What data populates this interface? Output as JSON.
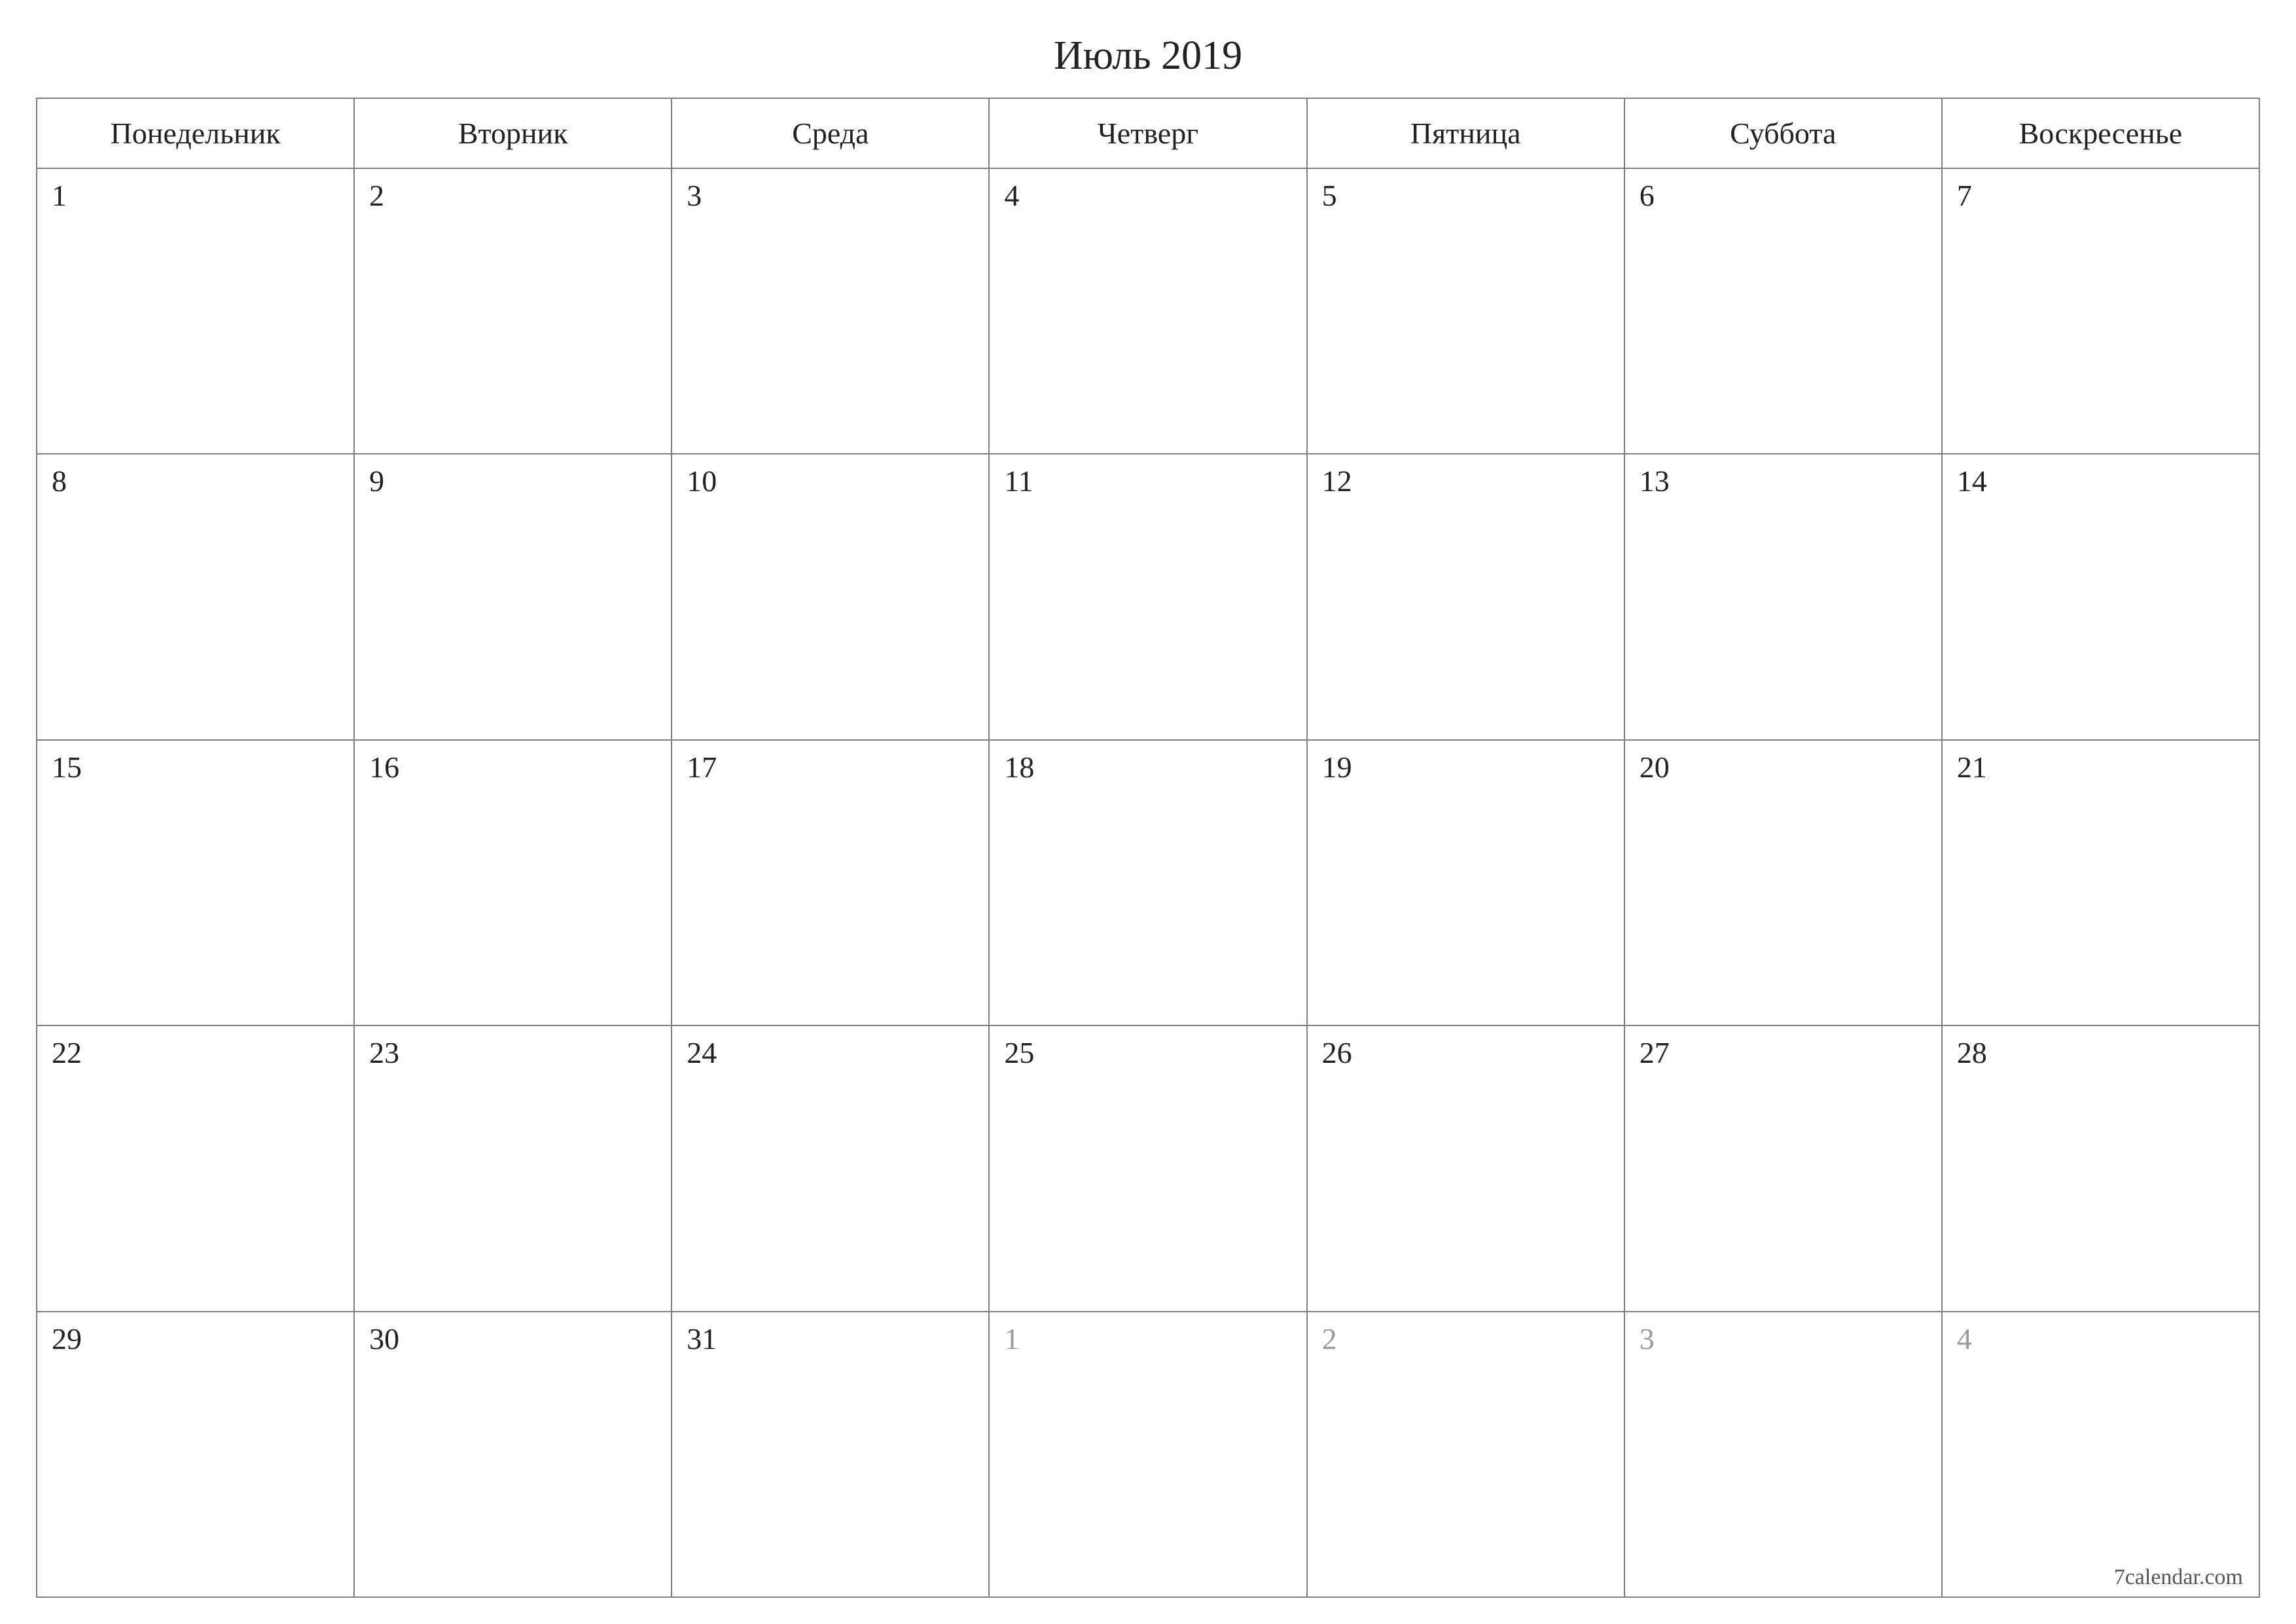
{
  "title": "Июль 2019",
  "weekdays": [
    "Понедельник",
    "Вторник",
    "Среда",
    "Четверг",
    "Пятница",
    "Суббота",
    "Воскресенье"
  ],
  "weeks": [
    [
      {
        "n": "1",
        "other": false
      },
      {
        "n": "2",
        "other": false
      },
      {
        "n": "3",
        "other": false
      },
      {
        "n": "4",
        "other": false
      },
      {
        "n": "5",
        "other": false
      },
      {
        "n": "6",
        "other": false
      },
      {
        "n": "7",
        "other": false
      }
    ],
    [
      {
        "n": "8",
        "other": false
      },
      {
        "n": "9",
        "other": false
      },
      {
        "n": "10",
        "other": false
      },
      {
        "n": "11",
        "other": false
      },
      {
        "n": "12",
        "other": false
      },
      {
        "n": "13",
        "other": false
      },
      {
        "n": "14",
        "other": false
      }
    ],
    [
      {
        "n": "15",
        "other": false
      },
      {
        "n": "16",
        "other": false
      },
      {
        "n": "17",
        "other": false
      },
      {
        "n": "18",
        "other": false
      },
      {
        "n": "19",
        "other": false
      },
      {
        "n": "20",
        "other": false
      },
      {
        "n": "21",
        "other": false
      }
    ],
    [
      {
        "n": "22",
        "other": false
      },
      {
        "n": "23",
        "other": false
      },
      {
        "n": "24",
        "other": false
      },
      {
        "n": "25",
        "other": false
      },
      {
        "n": "26",
        "other": false
      },
      {
        "n": "27",
        "other": false
      },
      {
        "n": "28",
        "other": false
      }
    ],
    [
      {
        "n": "29",
        "other": false
      },
      {
        "n": "30",
        "other": false
      },
      {
        "n": "31",
        "other": false
      },
      {
        "n": "1",
        "other": true
      },
      {
        "n": "2",
        "other": true
      },
      {
        "n": "3",
        "other": true
      },
      {
        "n": "4",
        "other": true
      }
    ]
  ],
  "footer": "7calendar.com"
}
